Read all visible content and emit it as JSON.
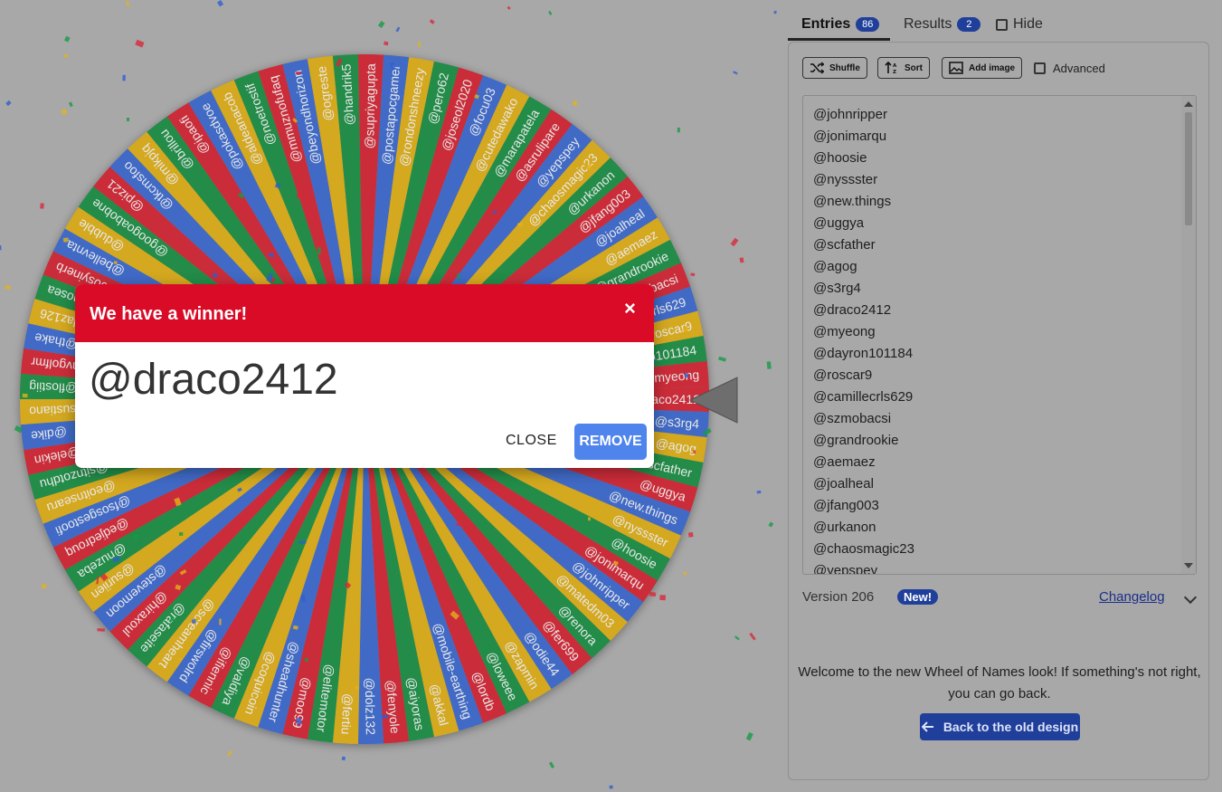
{
  "tabs": {
    "entries_label": "Entries",
    "entries_count": "86",
    "results_label": "Results",
    "results_count": "2",
    "hide_label": "Hide"
  },
  "toolbar": {
    "shuffle_label": "Shuffle",
    "sort_label": "Sort",
    "add_image_label": "Add image",
    "advanced_label": "Advanced"
  },
  "entries": [
    "@johnripper",
    "@jonimarqu",
    "@hoosie",
    "@nyssster",
    "@new.things",
    "@uggya",
    "@scfather",
    "@agog",
    "@s3rg4",
    "@draco2412",
    "@myeong",
    "@dayron101184",
    "@roscar9",
    "@camillecrls629",
    "@szmobacsi",
    "@grandrookie",
    "@aemaez",
    "@joalheal",
    "@jfang003",
    "@urkanon",
    "@chaosmagic23",
    "@yepspey"
  ],
  "footer": {
    "version": "Version 206",
    "new_badge": "New!",
    "changelog": "Changelog",
    "welcome": "Welcome to the new Wheel of Names look! If something's not right, you can go back.",
    "back_button": "Back to the old design"
  },
  "dialog": {
    "title": "We have a winner!",
    "close_x": "×",
    "winner": "@draco2412",
    "close_label": "CLOSE",
    "remove_label": "REMOVE"
  },
  "wheel": {
    "colors": [
      "#dc1a2a",
      "#3366d6",
      "#e7b10a",
      "#0e8f3c"
    ],
    "segment_names": [
      "@draco2412",
      "@s3rg4",
      "@agog",
      "@scfather",
      "@uggya",
      "@new.things",
      "@nyssster",
      "@hoosie",
      "@jonimarqu",
      "@johnripper",
      "@matedm03",
      "@renora",
      "@fer699",
      "@odie44",
      "@zapmin",
      "@loweee",
      "@lordb",
      "@mobile-earthing",
      "@akkal",
      "@aiyoras",
      "@fenyole",
      "@dolz132",
      "@fertiu",
      "@elitemotor",
      "@moo99",
      "@sheadhunter",
      "@coquicoin",
      "@valdiya",
      "@ifiennic",
      "@firswolrd",
      "@screamheart",
      "@rafaseite",
      "@hiraxoul",
      "@stevemoon",
      "@suriien",
      "@nuzeba",
      "@edjedrouq",
      "@fsosgestoofi",
      "@eoitnsearu",
      "@sitnzotdhu",
      "@elekin",
      "@dike",
      "@sustiano",
      "@flostiig",
      "@nvgolfmr",
      "@thake",
      "@daz126",
      "@hosea",
      "@2000syinerb",
      "@bellevnta",
      "@dubble",
      "@googoabobne",
      "@piz21",
      "@tkcmsfoo",
      "@mikpjq",
      "@brillou",
      "@ipaofi",
      "@pokasdvoe",
      "@aldeanacob",
      "@noetrostif",
      "@mmuznofufaq",
      "@beyondhorizon",
      "@ogreste",
      "@handrik5",
      "@supriyagupta",
      "@postapocgamer",
      "@rondonshneezy",
      "@pero62",
      "@joseol2020",
      "@focu03",
      "@cutedawako",
      "@marapatela",
      "@asrulipare",
      "@yepspey",
      "@chaosmagic23",
      "@urkanon",
      "@jfang003",
      "@joalheal",
      "@aemaez",
      "@grandrookie",
      "@szmobacsi",
      "@camillecrls629",
      "@roscar9",
      "@dayron101184",
      "@myeong"
    ]
  }
}
